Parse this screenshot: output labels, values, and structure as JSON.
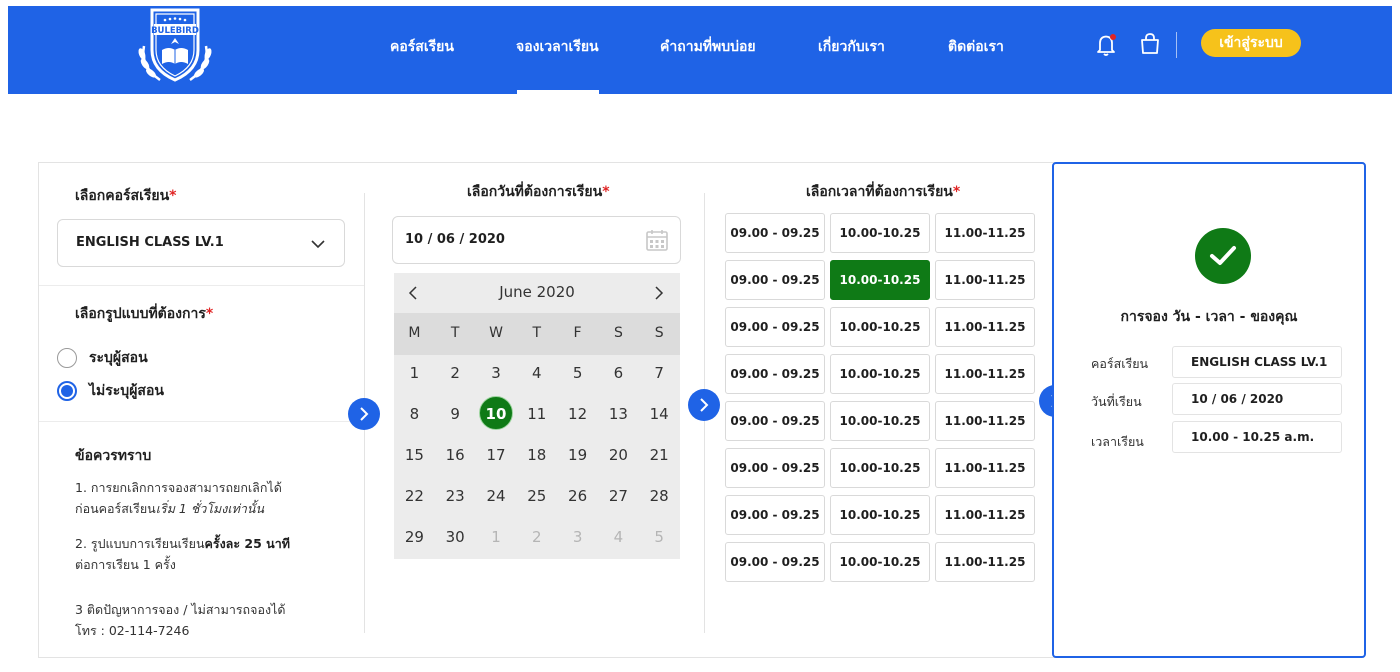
{
  "header": {
    "logo_text": "BULEBIRD",
    "nav": [
      {
        "label": "คอร์สเรียน"
      },
      {
        "label": "จองเวลาเรียน",
        "active": true
      },
      {
        "label": "คำถามที่พบบ่อย"
      },
      {
        "label": "เกี่ยวกับเรา"
      },
      {
        "label": "ติดต่อเรา"
      }
    ],
    "login_label": "เข้าสู่ระบบ",
    "brand_color": "#1f63e6",
    "login_color": "#f6c21b",
    "icons": [
      "bell-icon",
      "shopping-bag-icon"
    ]
  },
  "course": {
    "label": "เลือกคอร์สเรียน",
    "required_mark": "*",
    "selected": "ENGLISH CLASS LV.1"
  },
  "format": {
    "label": "เลือกรูปแบบที่ต้องการ",
    "required_mark": "*",
    "options": [
      {
        "label": "ระบุผู้สอน",
        "checked": false
      },
      {
        "label": "ไม่ระบุผู้สอน",
        "checked": true
      }
    ]
  },
  "notes": {
    "title": "ข้อควรทราบ",
    "n1_line1": "1. การยกเลิกการจองสามารถยกเลิกได้",
    "n1_line2_plain": "ก่อนคอร์สเรียน",
    "n1_line2_italic": "เริ่ม 1 ชั่วโมงเท่านั้น",
    "n2_line1_plain": "2. รูปแบบการเรียนเรียน",
    "n2_line1_bold": "ครั้งละ 25 นาที",
    "n2_line2": "ต่อการเรียน 1 ครั้ง",
    "n3_line1": "3 ติดปัญหาการจอง / ไม่สามารถจองได้",
    "n3_line2": "โทร : 02-114-7246"
  },
  "date": {
    "label": "เลือกวันที่ต้องการเรียน",
    "required_mark": "*",
    "value": "10 / 06 / 2020",
    "month_label": "June 2020",
    "weekdays": [
      "M",
      "T",
      "W",
      "T",
      "F",
      "S",
      "S"
    ],
    "days": [
      [
        "1",
        "2",
        "3",
        "4",
        "5",
        "6",
        "7"
      ],
      [
        "8",
        "9",
        "10",
        "11",
        "12",
        "13",
        "14"
      ],
      [
        "15",
        "16",
        "17",
        "18",
        "19",
        "20",
        "21"
      ],
      [
        "22",
        "23",
        "24",
        "25",
        "26",
        "27",
        "28"
      ],
      [
        "29",
        "30",
        "1",
        "2",
        "3",
        "4",
        "5"
      ]
    ],
    "selected_day": "10",
    "selected_color": "#0f7a16"
  },
  "time": {
    "label": "เลือกเวลาที่ต้องการเรียน",
    "required_mark": "*",
    "rows": [
      [
        "09.00 - 09.25",
        "10.00-10.25",
        "11.00-11.25"
      ],
      [
        "09.00 - 09.25",
        "10.00-10.25",
        "11.00-11.25"
      ],
      [
        "09.00 - 09.25",
        "10.00-10.25",
        "11.00-11.25"
      ],
      [
        "09.00 - 09.25",
        "10.00-10.25",
        "11.00-11.25"
      ],
      [
        "09.00 - 09.25",
        "10.00-10.25",
        "11.00-11.25"
      ],
      [
        "09.00 - 09.25",
        "10.00-10.25",
        "11.00-11.25"
      ],
      [
        "09.00 - 09.25",
        "10.00-10.25",
        "11.00-11.25"
      ],
      [
        "09.00 - 09.25",
        "10.00-10.25",
        "11.00-11.25"
      ]
    ],
    "active_row": 1,
    "active_col": 1
  },
  "summary": {
    "title": "การจอง วัน - เวลา - ของคุณ",
    "course_key": "คอร์สเรียน",
    "course_val": "ENGLISH CLASS LV.1",
    "date_key": "วันที่เรียน",
    "date_val": "10 / 06 / 2020",
    "time_key": "เวลาเรียน",
    "time_val": "10.00 - 10.25 a.m."
  }
}
